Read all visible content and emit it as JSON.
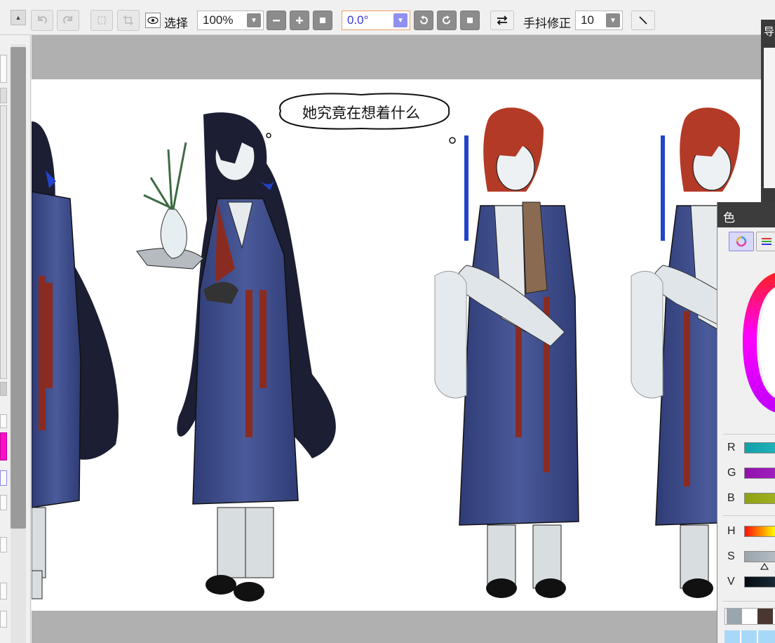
{
  "toolbar": {
    "select_label": "选择",
    "zoom_value": "100%",
    "angle_value": "0.0°",
    "stabilizer_label": "手抖修正",
    "stabilizer_value": "10"
  },
  "canvas": {
    "speech_bubble_text": "她究竟在想着什么"
  },
  "color_panel": {
    "title": "色",
    "sliders": [
      "R",
      "G",
      "B",
      "H",
      "S",
      "V"
    ]
  },
  "nav_panel": {
    "title_glyph": "导"
  },
  "colors": {
    "panel_dark": "#3c3c3c",
    "robe_blue": "#3f4f8e",
    "hair_red": "#b33a26",
    "hair_black": "#1c1f33"
  }
}
